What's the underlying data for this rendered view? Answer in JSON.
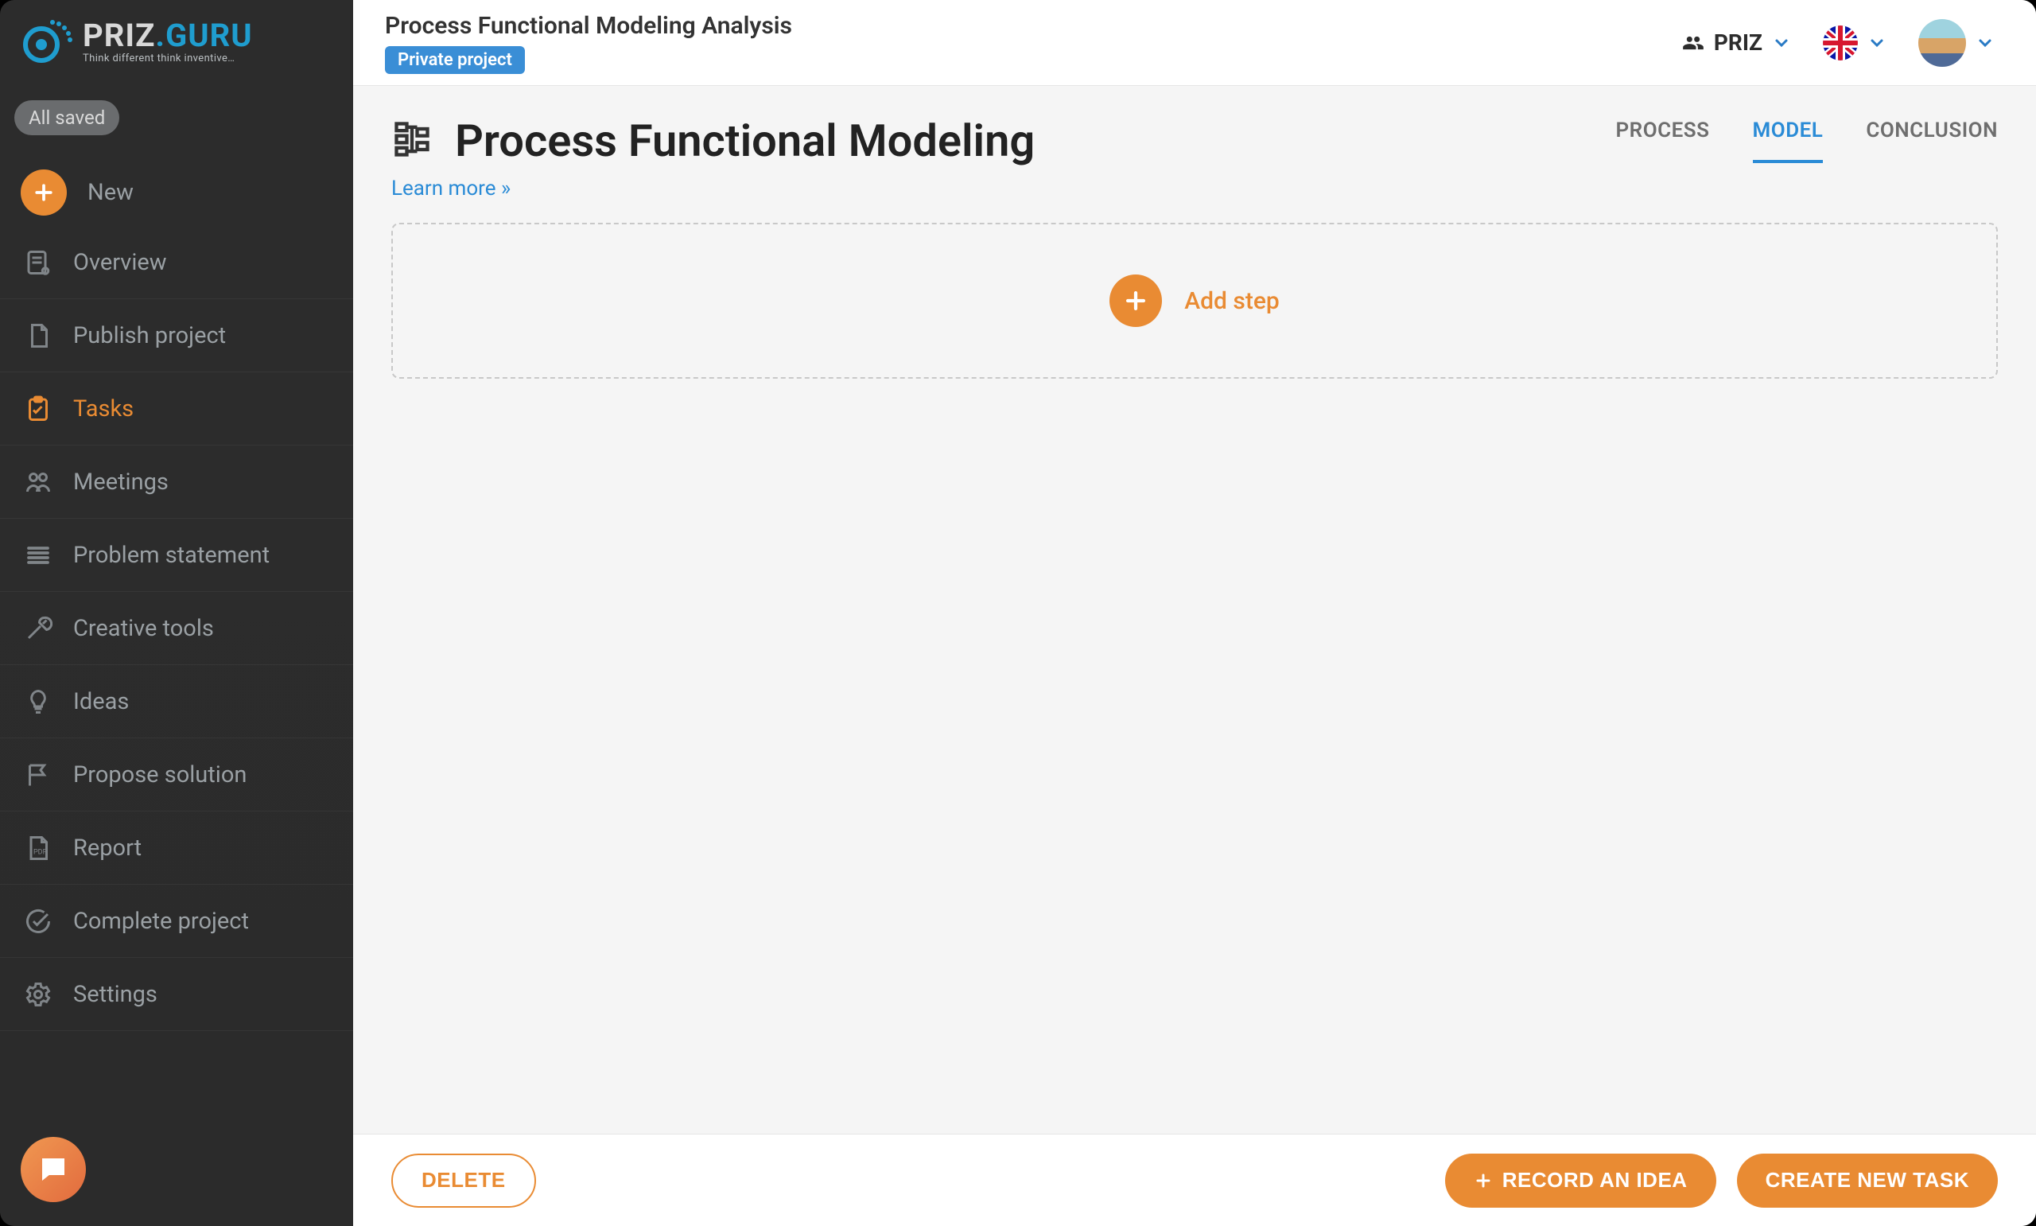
{
  "brand": {
    "name_prefix": "PRIZ",
    "name_suffix": ".GURU",
    "tagline": "Think different think inventive…"
  },
  "sidebar": {
    "save_state": "All saved",
    "new_label": "New",
    "items": [
      {
        "label": "Overview",
        "icon": "overview"
      },
      {
        "label": "Publish project",
        "icon": "document"
      },
      {
        "label": "Tasks",
        "icon": "clipboard"
      },
      {
        "label": "Meetings",
        "icon": "people"
      },
      {
        "label": "Problem statement",
        "icon": "lines"
      },
      {
        "label": "Creative tools",
        "icon": "tools"
      },
      {
        "label": "Ideas",
        "icon": "bulb"
      },
      {
        "label": "Propose solution",
        "icon": "flag"
      },
      {
        "label": "Report",
        "icon": "report"
      },
      {
        "label": "Complete project",
        "icon": "check-circle"
      },
      {
        "label": "Settings",
        "icon": "gear"
      }
    ],
    "active_index": 2
  },
  "header": {
    "project_title": "Process Functional Modeling Analysis",
    "privacy_badge": "Private project",
    "workspace_name": "PRIZ"
  },
  "page": {
    "title": "Process Functional Modeling",
    "learn_more": "Learn more »",
    "tabs": [
      "PROCESS",
      "MODEL",
      "CONCLUSION"
    ],
    "active_tab_index": 1,
    "add_step_label": "Add step"
  },
  "footer": {
    "delete_label": "DELETE",
    "record_idea_label": "RECORD AN IDEA",
    "create_task_label": "CREATE NEW TASK"
  }
}
